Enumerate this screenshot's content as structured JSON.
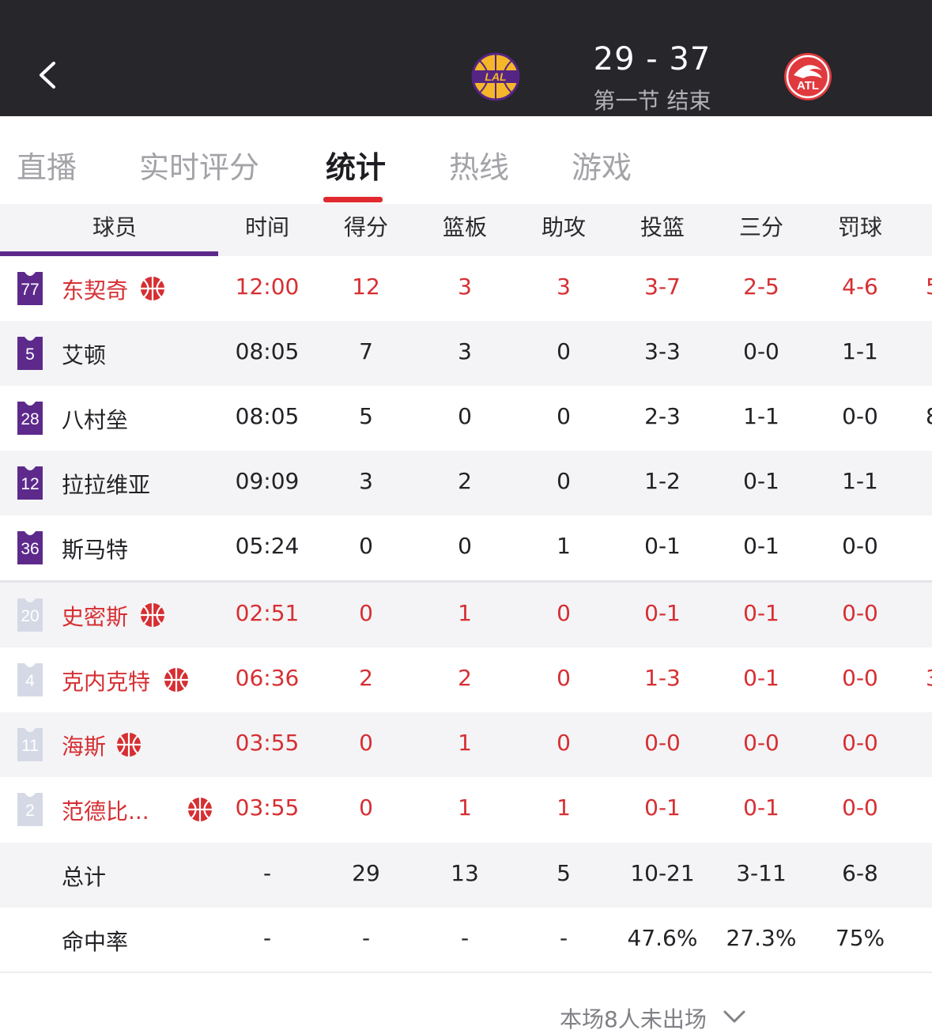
{
  "header": {
    "home_abbr": "LAL",
    "away_abbr": "ATL",
    "score": "29 - 37",
    "period": "第一节 结束"
  },
  "tabs": [
    {
      "label": "直播",
      "active": false
    },
    {
      "label": "实时评分",
      "active": false
    },
    {
      "label": "统计",
      "active": true
    },
    {
      "label": "热线",
      "active": false
    },
    {
      "label": "游戏",
      "active": false
    }
  ],
  "table": {
    "columns": [
      "球员",
      "时间",
      "得分",
      "篮板",
      "助攻",
      "投篮",
      "三分",
      "罚球"
    ],
    "edge_header": "（",
    "rows": [
      {
        "num": "77",
        "name": "东契奇",
        "time": "12:00",
        "pts": "12",
        "reb": "3",
        "ast": "3",
        "fg": "3-7",
        "three": "2-5",
        "ft": "4-6",
        "edge": "5",
        "highlight": true,
        "ball": true,
        "starter": true
      },
      {
        "num": "5",
        "name": "艾顿",
        "time": "08:05",
        "pts": "7",
        "reb": "3",
        "ast": "0",
        "fg": "3-3",
        "three": "0-0",
        "ft": "1-1",
        "edge": "",
        "highlight": false,
        "ball": false,
        "starter": true
      },
      {
        "num": "28",
        "name": "八村垒",
        "time": "08:05",
        "pts": "5",
        "reb": "0",
        "ast": "0",
        "fg": "2-3",
        "three": "1-1",
        "ft": "0-0",
        "edge": "8",
        "highlight": false,
        "ball": false,
        "starter": true
      },
      {
        "num": "12",
        "name": "拉拉维亚",
        "time": "09:09",
        "pts": "3",
        "reb": "2",
        "ast": "0",
        "fg": "1-2",
        "three": "0-1",
        "ft": "1-1",
        "edge": "",
        "highlight": false,
        "ball": false,
        "starter": true
      },
      {
        "num": "36",
        "name": "斯马特",
        "time": "05:24",
        "pts": "0",
        "reb": "0",
        "ast": "1",
        "fg": "0-1",
        "three": "0-1",
        "ft": "0-0",
        "edge": "",
        "highlight": false,
        "ball": false,
        "starter": true
      },
      {
        "num": "20",
        "name": "史密斯",
        "time": "02:51",
        "pts": "0",
        "reb": "1",
        "ast": "0",
        "fg": "0-1",
        "three": "0-1",
        "ft": "0-0",
        "edge": "",
        "highlight": true,
        "ball": true,
        "starter": false
      },
      {
        "num": "4",
        "name": "克内克特",
        "time": "06:36",
        "pts": "2",
        "reb": "2",
        "ast": "0",
        "fg": "1-3",
        "three": "0-1",
        "ft": "0-0",
        "edge": "3",
        "highlight": true,
        "ball": true,
        "starter": false
      },
      {
        "num": "11",
        "name": "海斯",
        "time": "03:55",
        "pts": "0",
        "reb": "1",
        "ast": "0",
        "fg": "0-0",
        "three": "0-0",
        "ft": "0-0",
        "edge": "",
        "highlight": true,
        "ball": true,
        "starter": false
      },
      {
        "num": "2",
        "name": "范德比...",
        "time": "03:55",
        "pts": "0",
        "reb": "1",
        "ast": "1",
        "fg": "0-1",
        "three": "0-1",
        "ft": "0-0",
        "edge": "",
        "highlight": true,
        "ball": true,
        "starter": false
      }
    ],
    "totals": {
      "label": "总计",
      "time": "-",
      "pts": "29",
      "reb": "13",
      "ast": "5",
      "fg": "10-21",
      "three": "3-11",
      "ft": "6-8"
    },
    "pct": {
      "label": "命中率",
      "time": "-",
      "pts": "-",
      "reb": "-",
      "ast": "-",
      "fg": "47.6%",
      "three": "27.3%",
      "ft": "75%"
    }
  },
  "footer": {
    "dnp_text": "本场8人未出场"
  },
  "colors": {
    "header_bg": "#26262b",
    "accent_red": "#d62f33",
    "lakers_purple": "#5d2a8c",
    "bench_jersey": "#d5d9e6"
  }
}
